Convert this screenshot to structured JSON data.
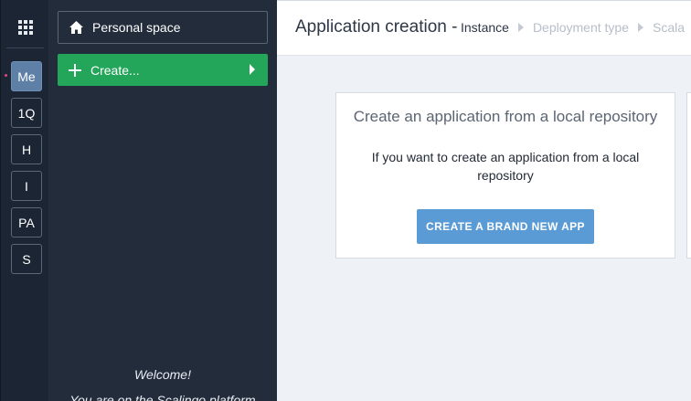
{
  "rail": {
    "orgs": [
      {
        "label": "Me",
        "active": true
      },
      {
        "label": "1Q",
        "active": false
      },
      {
        "label": "H",
        "active": false
      },
      {
        "label": "I",
        "active": false
      },
      {
        "label": "PA",
        "active": false
      },
      {
        "label": "S",
        "active": false
      }
    ]
  },
  "panel": {
    "space_label": "Personal space",
    "create_label": "Create...",
    "welcome": "Welcome!",
    "welcome_sub": "You are on the Scalingo platform"
  },
  "header": {
    "title": "Application creation -",
    "steps": [
      "Instance",
      "Deployment type",
      "Scala"
    ]
  },
  "card": {
    "title": "Create an application from a local repository",
    "description": "If you want to create an application from a local repository",
    "button_label": "CREATE A BRAND NEW APP"
  },
  "colors": {
    "rail_bg": "#1c2533",
    "panel_bg": "#232c3b",
    "create_green": "#23a55a",
    "primary_blue": "#5b9bd5",
    "active_org": "#5e7fa6"
  },
  "icons": [
    "apps-grid-icon",
    "home-icon",
    "plus-icon",
    "caret-right-icon",
    "breadcrumb-arrow-icon"
  ]
}
